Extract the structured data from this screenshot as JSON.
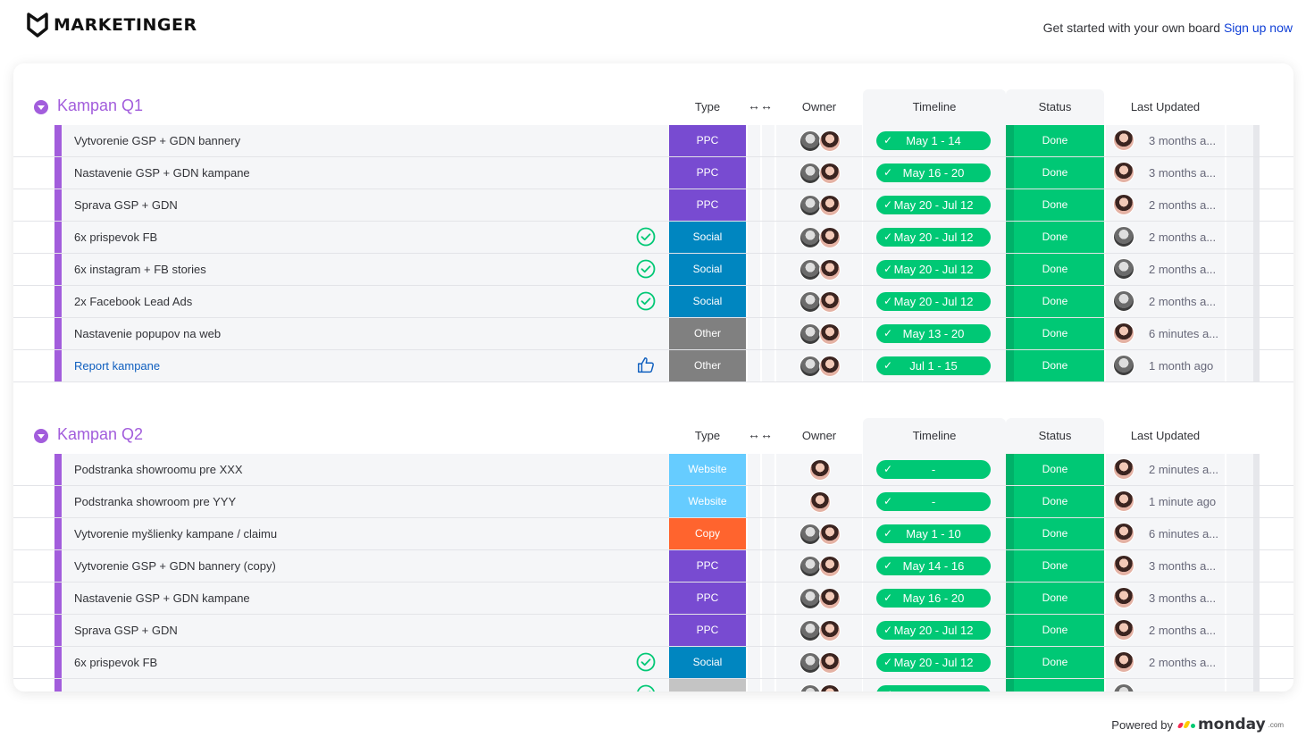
{
  "header": {
    "brand": "MARKETINGER",
    "cta_text": "Get started with your own board",
    "cta_link": "Sign up now"
  },
  "columns": {
    "type": "Type",
    "owner": "Owner",
    "timeline": "Timeline",
    "status": "Status",
    "last_updated": "Last Updated",
    "arrows": "↔↔"
  },
  "colors": {
    "accent": "#a25ddc",
    "done": "#00c875",
    "ppc": "#784bd1",
    "social": "#0086c0",
    "other": "#808080",
    "website": "#66ccff",
    "copy": "#ff642e"
  },
  "groups": [
    {
      "title": "Kampan Q1",
      "rows": [
        {
          "name": "Vytvorenie GSP + GDN bannery",
          "type": "PPC",
          "owners": 2,
          "timeline": "May 1 - 14",
          "status": "Done",
          "updated": "3 months a...",
          "upd_icon": "",
          "link": false,
          "updater": "a2"
        },
        {
          "name": "Nastavenie GSP + GDN kampane",
          "type": "PPC",
          "owners": 2,
          "timeline": "May 16 - 20",
          "status": "Done",
          "updated": "3 months a...",
          "upd_icon": "",
          "link": false,
          "updater": "a2"
        },
        {
          "name": "Sprava GSP + GDN",
          "type": "PPC",
          "owners": 2,
          "timeline": "May 20 - Jul 12",
          "status": "Done",
          "updated": "2 months a...",
          "upd_icon": "",
          "link": false,
          "updater": "a2"
        },
        {
          "name": "6x prispevok FB",
          "type": "Social",
          "owners": 2,
          "timeline": "May 20 - Jul 12",
          "status": "Done",
          "updated": "2 months a...",
          "upd_icon": "check-circle-icon",
          "link": false,
          "updater": "a1"
        },
        {
          "name": "6x instagram + FB stories",
          "type": "Social",
          "owners": 2,
          "timeline": "May 20 - Jul 12",
          "status": "Done",
          "updated": "2 months a...",
          "upd_icon": "check-circle-icon",
          "link": false,
          "updater": "a1"
        },
        {
          "name": "2x Facebook Lead Ads",
          "type": "Social",
          "owners": 2,
          "timeline": "May 20 - Jul 12",
          "status": "Done",
          "updated": "2 months a...",
          "upd_icon": "check-circle-icon",
          "link": false,
          "updater": "a1"
        },
        {
          "name": "Nastavenie popupov na web",
          "type": "Other",
          "owners": 2,
          "timeline": "May 13 - 20",
          "status": "Done",
          "updated": "6 minutes a...",
          "upd_icon": "",
          "link": false,
          "updater": "a2"
        },
        {
          "name": "Report kampane",
          "type": "Other",
          "owners": 2,
          "timeline": "Jul 1 - 15",
          "status": "Done",
          "updated": "1 month ago",
          "upd_icon": "thumbs-up-icon",
          "link": true,
          "updater": "a1"
        }
      ]
    },
    {
      "title": "Kampan Q2",
      "rows": [
        {
          "name": "Podstranka showroomu pre XXX",
          "type": "Website",
          "owners": 1,
          "timeline": "-",
          "status": "Done",
          "updated": "2 minutes a...",
          "upd_icon": "",
          "link": false,
          "updater": "a2"
        },
        {
          "name": "Podstranka showroom pre YYY",
          "type": "Website",
          "owners": 1,
          "timeline": "-",
          "status": "Done",
          "updated": "1 minute ago",
          "upd_icon": "",
          "link": false,
          "updater": "a2"
        },
        {
          "name": "Vytvorenie myšlienky kampane / claimu",
          "type": "Copy",
          "owners": 2,
          "timeline": "May 1 - 10",
          "status": "Done",
          "updated": "6 minutes a...",
          "upd_icon": "",
          "link": false,
          "updater": "a2"
        },
        {
          "name": "Vytvorenie GSP + GDN bannery (copy)",
          "type": "PPC",
          "owners": 2,
          "timeline": "May 14 - 16",
          "status": "Done",
          "updated": "3 months a...",
          "upd_icon": "",
          "link": false,
          "updater": "a2"
        },
        {
          "name": "Nastavenie GSP + GDN kampane",
          "type": "PPC",
          "owners": 2,
          "timeline": "May 16 - 20",
          "status": "Done",
          "updated": "3 months a...",
          "upd_icon": "",
          "link": false,
          "updater": "a2"
        },
        {
          "name": "Sprava GSP + GDN",
          "type": "PPC",
          "owners": 2,
          "timeline": "May 20 - Jul 12",
          "status": "Done",
          "updated": "2 months a...",
          "upd_icon": "",
          "link": false,
          "updater": "a2"
        },
        {
          "name": "6x prispevok FB",
          "type": "Social",
          "owners": 2,
          "timeline": "May 20 - Jul 12",
          "status": "Done",
          "updated": "2 months a...",
          "upd_icon": "check-circle-icon",
          "link": false,
          "updater": "a2"
        },
        {
          "name": "",
          "type": "",
          "owners": 2,
          "timeline": "",
          "status": "",
          "updated": "",
          "upd_icon": "check-circle-icon",
          "link": false,
          "updater": "a1"
        }
      ]
    }
  ],
  "footer": {
    "powered_by": "Powered by",
    "brand": "monday",
    "brand_suffix": ".com"
  }
}
